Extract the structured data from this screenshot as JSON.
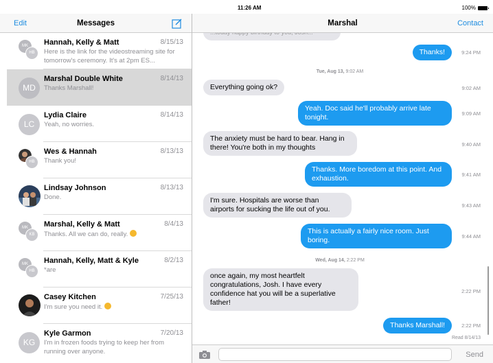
{
  "status": {
    "device": "iPad",
    "time": "11:26 AM",
    "battery": "100%"
  },
  "left": {
    "edit_label": "Edit",
    "title": "Messages",
    "conversations": [
      {
        "name": "Hannah, Kelly & Matt",
        "date": "8/15/13",
        "preview": "Here is the link for the videostreaming site for tomorrow's ceremony. It's at 2pm ES...",
        "avatar": "group",
        "initials": [
          "MK",
          "HB"
        ]
      },
      {
        "name": "Marshal Double White",
        "date": "8/14/13",
        "preview": "Thanks Marshall!",
        "avatar": "initials",
        "initials": "MD",
        "selected": true
      },
      {
        "name": "Lydia Claire",
        "date": "8/14/13",
        "preview": "Yeah, no worries.",
        "avatar": "initials",
        "initials": "LC"
      },
      {
        "name": "Wes & Hannah",
        "date": "8/13/13",
        "preview": "Thank you!",
        "avatar": "group-photo",
        "initials": [
          "",
          "HB"
        ]
      },
      {
        "name": "Lindsay Johnson",
        "date": "8/13/13",
        "preview": "Done.",
        "avatar": "photo"
      },
      {
        "name": "Marshal, Kelly & Matt",
        "date": "8/4/13",
        "preview": "Thanks. All we can do, really.",
        "avatar": "group",
        "initials": [
          "MK",
          "KB"
        ],
        "emoji": true
      },
      {
        "name": "Hannah, Kelly, Matt & Kyle",
        "date": "8/2/13",
        "preview": "*are",
        "avatar": "group",
        "initials": [
          "MK",
          "HB"
        ]
      },
      {
        "name": "Casey Kitchen",
        "date": "7/25/13",
        "preview": "I'm sure you need it.",
        "avatar": "photo-dark",
        "emoji": true
      },
      {
        "name": "Kyle Garmon",
        "date": "7/20/13",
        "preview": "I'm in frozen foods trying to keep her from running over anyone.",
        "avatar": "initials",
        "initials": "KG"
      }
    ]
  },
  "right": {
    "title": "Marshal",
    "contact_label": "Contact",
    "cut_text": "...today happy birthday to you, Josh...",
    "messages": [
      {
        "dir": "out",
        "text": "Thanks!",
        "time": "9:24 PM"
      },
      {
        "stamp_day": "Tue, Aug 13,",
        "stamp_time": "9:02 AM"
      },
      {
        "dir": "in",
        "text": "Everything going ok?",
        "time": "9:02 AM"
      },
      {
        "dir": "out",
        "text": "Yeah. Doc said he'll probably arrive late tonight.",
        "time": "9:09 AM"
      },
      {
        "dir": "in",
        "text": "The anxiety must be hard to bear. Hang in there! You're both in my thoughts",
        "time": "9:40 AM"
      },
      {
        "dir": "out",
        "text": "Thanks. More boredom at this point. And exhaustion.",
        "time": "9:41 AM"
      },
      {
        "dir": "in",
        "text": "I'm sure. Hospitals are worse than airports for sucking the life out of you.",
        "time": "9:43 AM"
      },
      {
        "dir": "out",
        "text": "This is actually a fairly nice room. Just boring.",
        "time": "9:44 AM"
      },
      {
        "stamp_day": "Wed, Aug 14,",
        "stamp_time": "2:22 PM"
      },
      {
        "dir": "in",
        "text": "once again, my most heartfelt congratulations, Josh. I have every confidence hat you will be a superlative father!",
        "time": "2:22 PM"
      },
      {
        "dir": "out",
        "text": "Thanks Marshall!",
        "time": "2:22 PM"
      }
    ],
    "read_receipt": "Read 8/14/13",
    "input_placeholder": "",
    "send_label": "Send"
  }
}
